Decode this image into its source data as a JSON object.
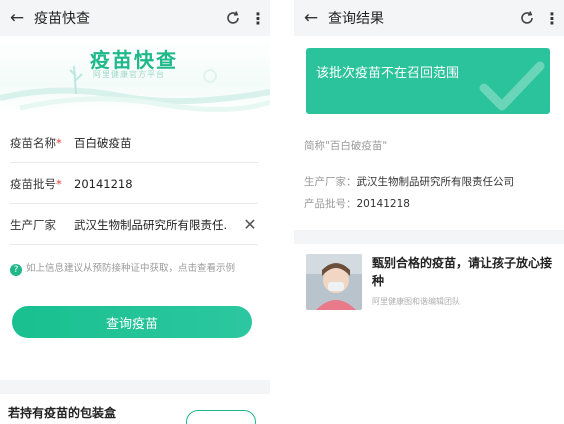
{
  "left": {
    "header": {
      "title": "疫苗快查"
    },
    "banner": {
      "brand": "疫苗快查",
      "slogan": "阿里健康官方平台"
    },
    "form": {
      "name_label": "疫苗名称",
      "name_value": "百白破疫苗",
      "batch_label": "疫苗批号",
      "batch_value": "20141218",
      "maker_label": "生产厂家",
      "maker_value": "武汉生物制品研究所有限责任."
    },
    "hint": "如上信息建议从预防接种证中获取，点击查看示例",
    "query_button": "查询疫苗",
    "package_title": "若持有疫苗的包装盒"
  },
  "right": {
    "header": {
      "title": "查询结果"
    },
    "result": {
      "message": "该批次疫苗不在召回范围"
    },
    "short_name": "简称\"百白破疫苗\"",
    "maker": {
      "label": "生产厂家：",
      "value": "武汉生物制品研究所有限责任公司"
    },
    "batch": {
      "label": "产品批号：",
      "value": "20141218"
    },
    "article": {
      "title": "甄别合格的疫苗，请让孩子放心接种",
      "source": "阿里健康图和谐编辑团队"
    }
  },
  "icons": {
    "back": "back-arrow-icon",
    "refresh": "refresh-icon",
    "more": "more-vertical-icon",
    "clear": "clear-icon",
    "help": "question-icon",
    "check": "check-watermark-icon"
  },
  "colors": {
    "accent": "#1fb88a",
    "result_bg": "#2bc39b",
    "required": "#e23b3b"
  }
}
